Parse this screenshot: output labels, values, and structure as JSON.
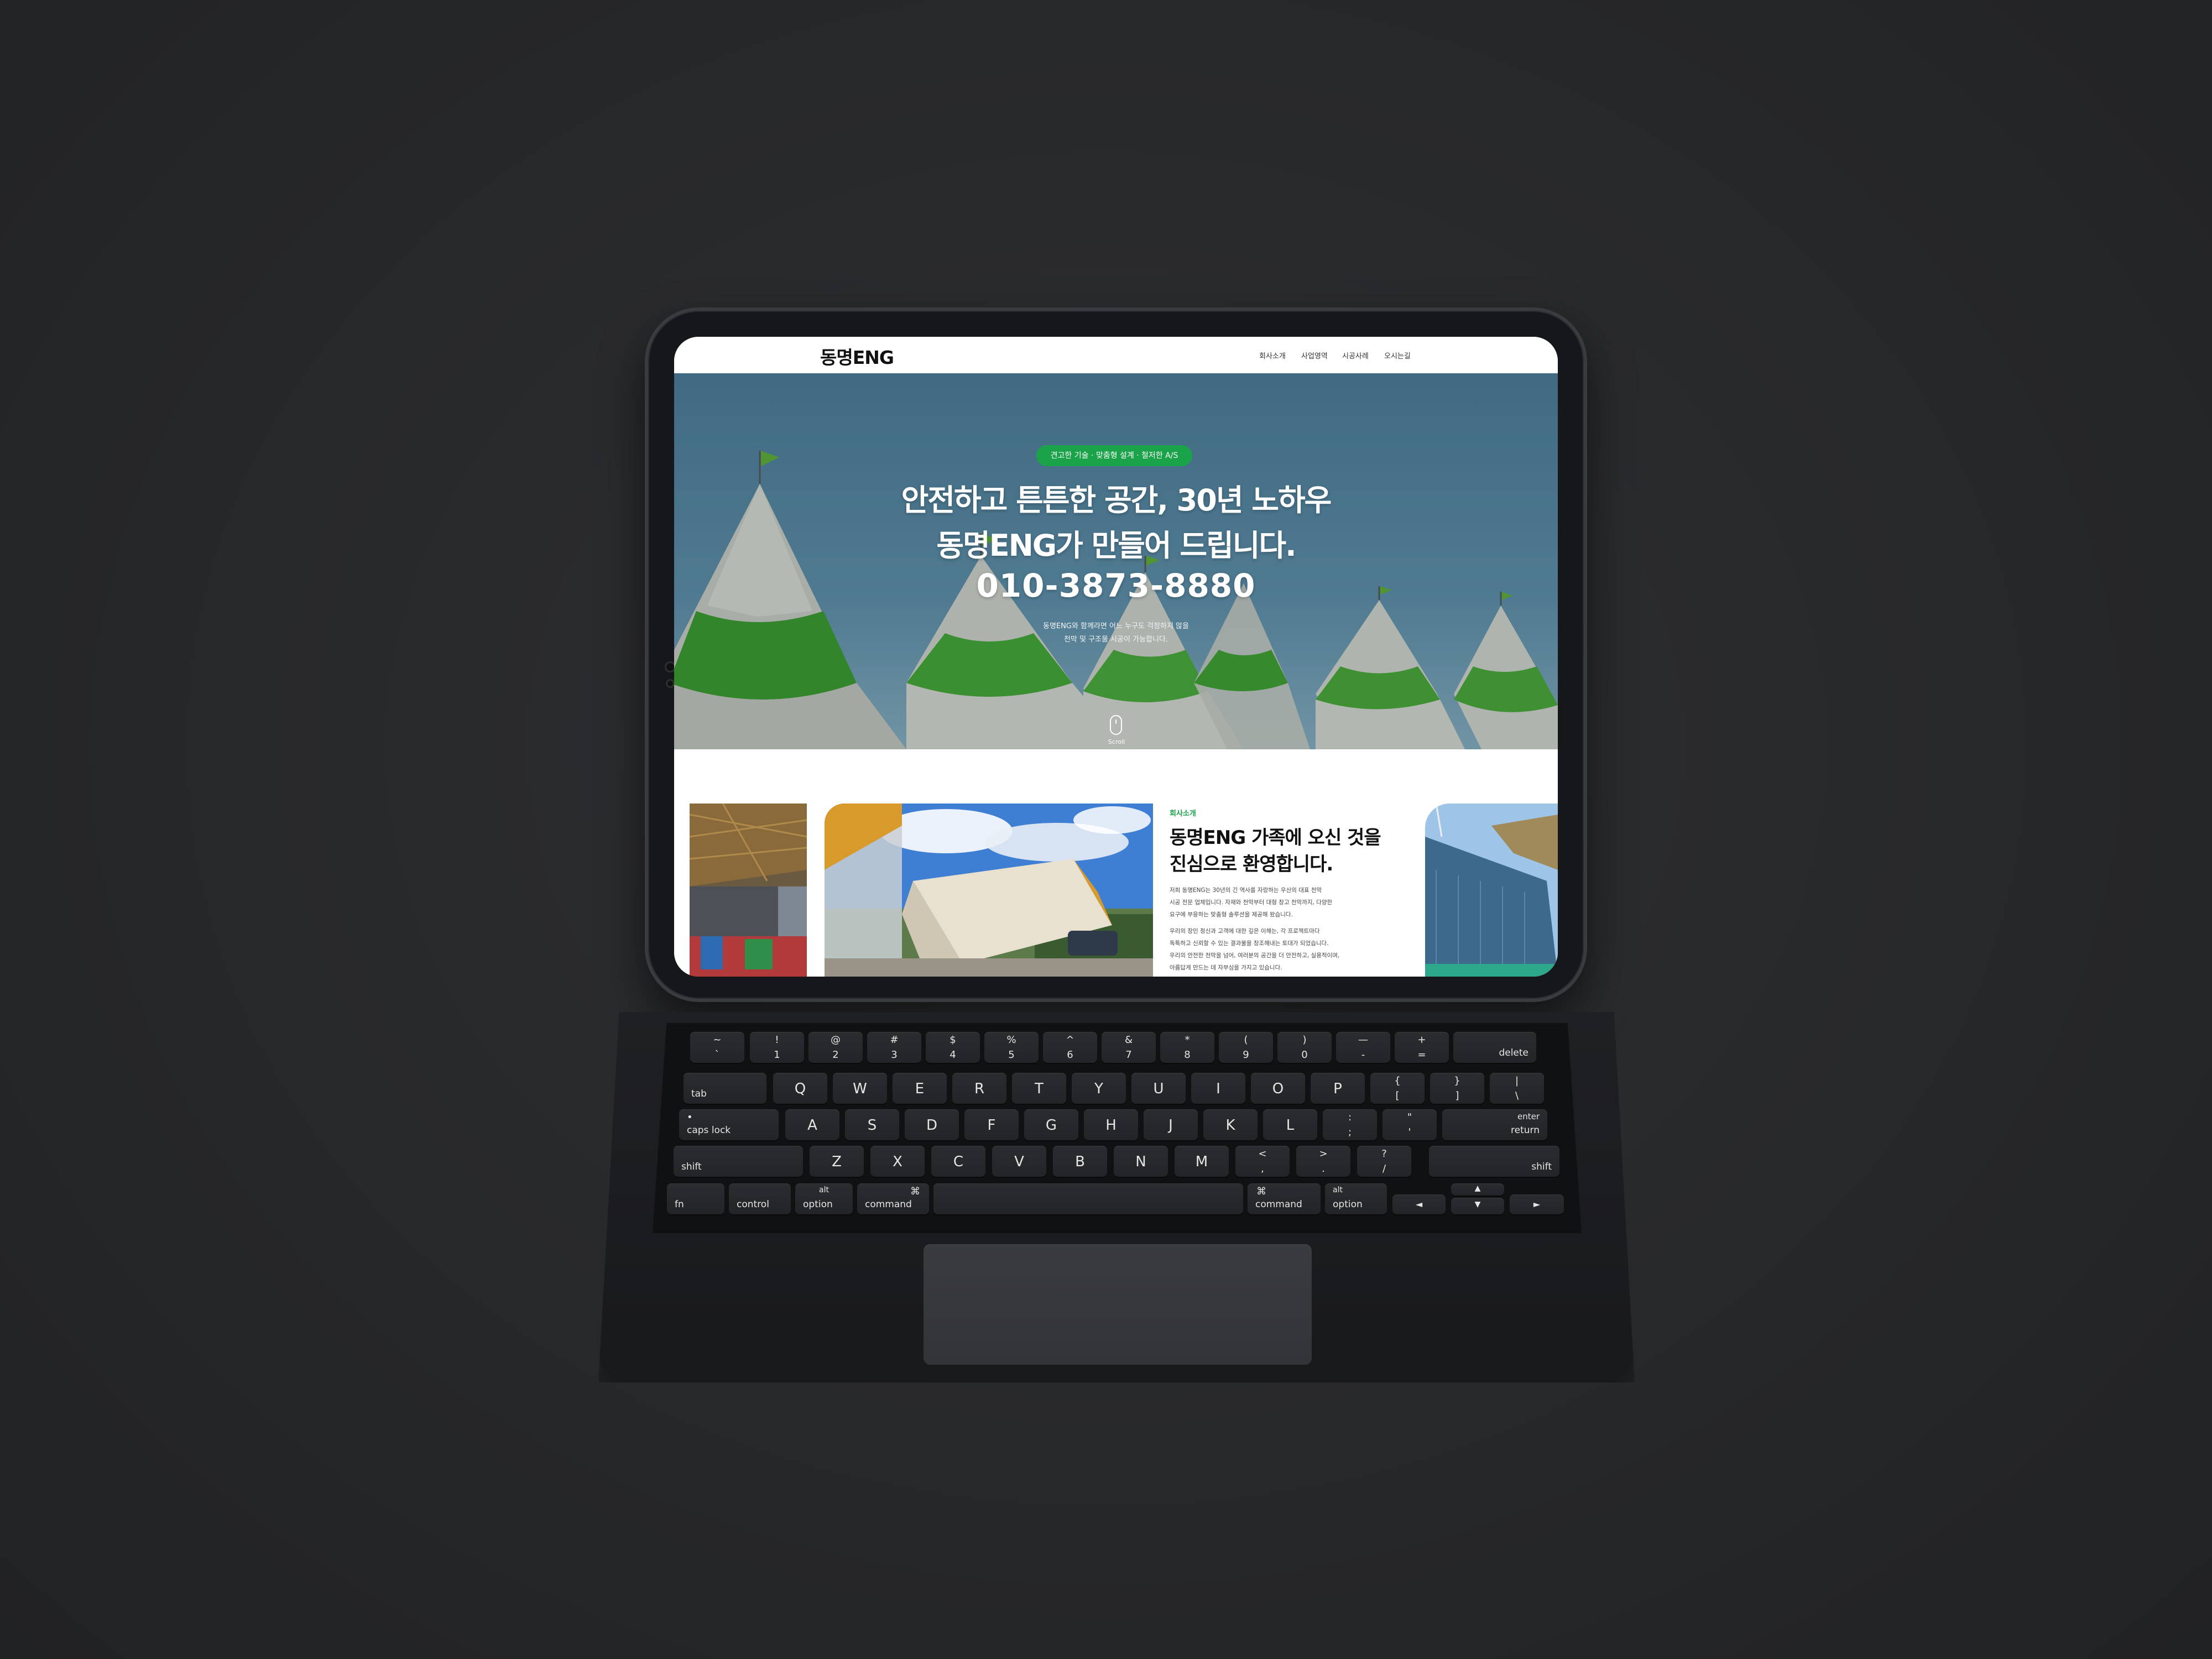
{
  "site": {
    "logo": "동명ENG",
    "nav": [
      "회사소개",
      "사업영역",
      "시공사례",
      "오시는길"
    ]
  },
  "hero": {
    "badge": "견고한 기술 · 맞춤형 설계 · 철저한 A/S",
    "title_line1": "안전하고 튼튼한 공간, 30년 노하우",
    "title_line2": "동명ENG가 만들어 드립니다.",
    "phone": "010-3873-8880",
    "sub_line1": "동명ENG와 함께라면 어느 누구도 걱정하지 않을",
    "sub_line2": "천막 및 구조물 시공이 가능합니다.",
    "scroll_label": "Scroll"
  },
  "about": {
    "tag": "회사소개",
    "title_line1": "동명ENG 가족에 오신 것을",
    "title_line2": "진심으로 환영합니다.",
    "para1": [
      "저희 동명ENG는 30년의 긴 역사를 자랑하는 우산의 대표 천막",
      "시공 전문 업체입니다. 자재와 천막부터 대형 창고 천막까지, 다양한",
      "요구에 부응하는 맞춤형 솔루션을 제공해 왔습니다."
    ],
    "para2": [
      "우리의 장인 정신과 고객에 대한 깊은 이해는, 각 프로젝트마다",
      "독특하고 신뢰할 수 있는 결과물을 창조해내는 토대가 되었습니다.",
      "우리의 안전한 천막을 넘어, 여러분의 공간을 더 안전하고, 실용적이며,",
      "아름답게 만드는 데 자부심을 가지고 있습니다."
    ]
  },
  "keyboard": {
    "row1": [
      {
        "t": "~",
        "b": "`"
      },
      {
        "t": "!",
        "b": "1"
      },
      {
        "t": "@",
        "b": "2"
      },
      {
        "t": "#",
        "b": "3"
      },
      {
        "t": "$",
        "b": "4"
      },
      {
        "t": "%",
        "b": "5"
      },
      {
        "t": "^",
        "b": "6"
      },
      {
        "t": "&",
        "b": "7"
      },
      {
        "t": "*",
        "b": "8"
      },
      {
        "t": "(",
        "b": "9"
      },
      {
        "t": ")",
        "b": "0"
      },
      {
        "t": "—",
        "b": "-"
      },
      {
        "t": "+",
        "b": "="
      }
    ],
    "delete": "delete",
    "tab": "tab",
    "row2": [
      "Q",
      "W",
      "E",
      "R",
      "T",
      "Y",
      "U",
      "I",
      "O",
      "P"
    ],
    "row2_extra": [
      {
        "t": "{",
        "b": "["
      },
      {
        "t": "}",
        "b": "]"
      },
      {
        "t": "|",
        "b": "\\"
      }
    ],
    "caps": "caps lock",
    "row3": [
      "A",
      "S",
      "D",
      "F",
      "G",
      "H",
      "J",
      "K",
      "L"
    ],
    "row3_extra": [
      {
        "t": ":",
        "b": ";"
      },
      {
        "t": "\"",
        "b": "'"
      }
    ],
    "enter": "enter",
    "return": "return",
    "shift": "shift",
    "row4": [
      "Z",
      "X",
      "C",
      "V",
      "B",
      "N",
      "M"
    ],
    "row4_extra": [
      {
        "t": "<",
        "b": ","
      },
      {
        "t": ">",
        "b": "."
      },
      {
        "t": "?",
        "b": "/"
      }
    ],
    "fn": "fn",
    "control": "control",
    "alt": "alt",
    "option": "option",
    "cmd_symbol": "⌘",
    "command": "command",
    "arrows": {
      "left": "◄",
      "up": "▲",
      "down": "▼",
      "right": "►"
    }
  },
  "colors": {
    "accent_green": "#1aa348",
    "background": "#27282a",
    "device": "#16171a"
  }
}
